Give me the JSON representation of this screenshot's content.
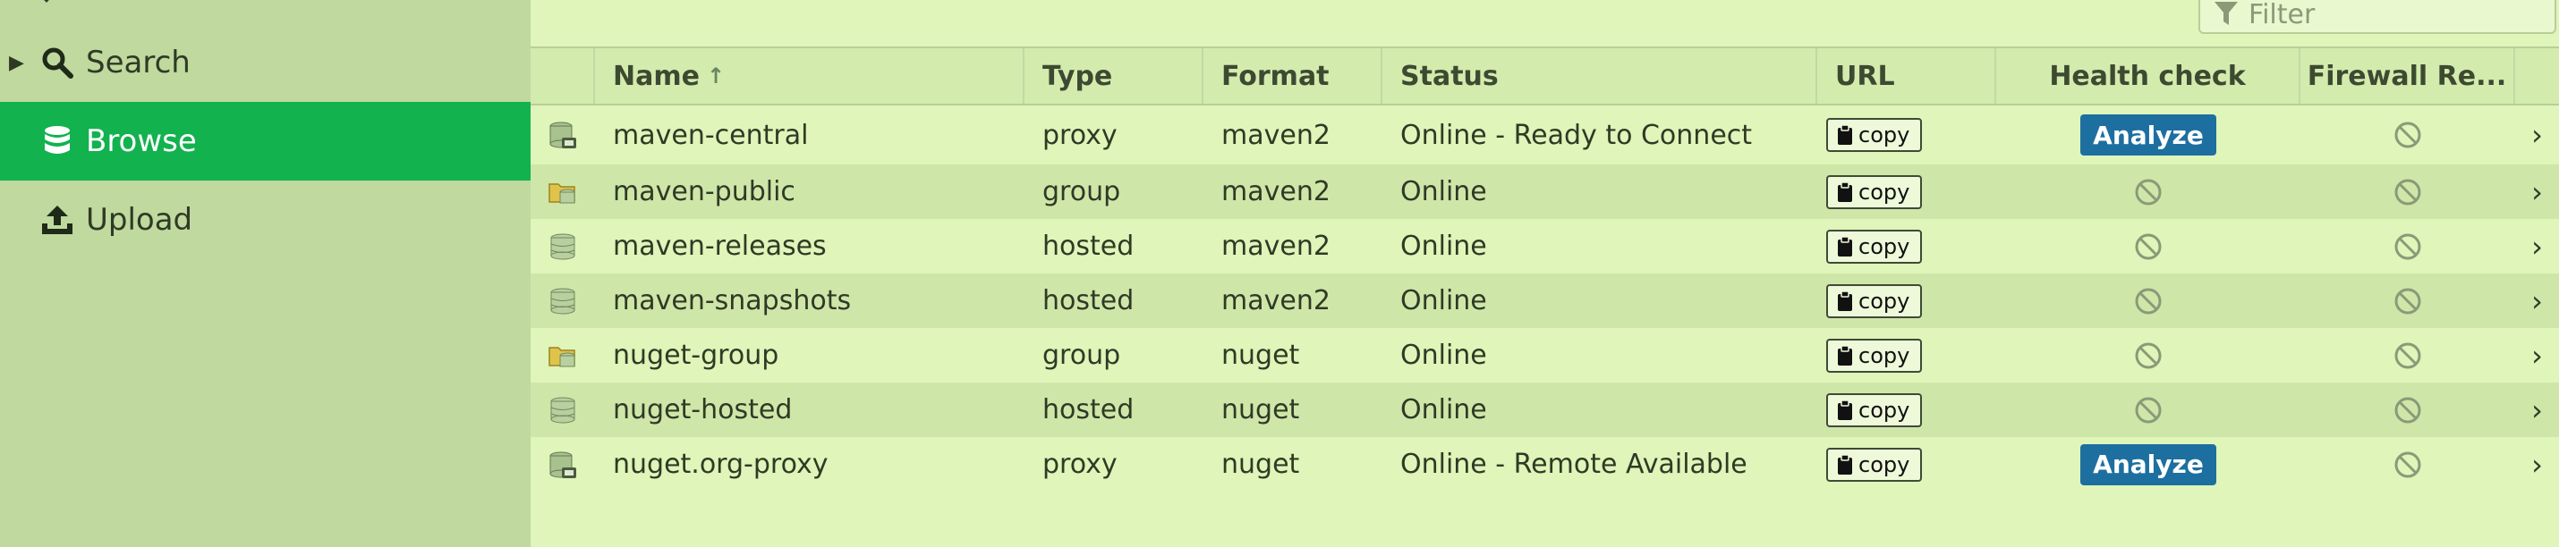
{
  "sidebar": {
    "items": [
      {
        "label": "Search",
        "icon": "search-icon"
      },
      {
        "label": "Browse",
        "icon": "database-icon",
        "active": true
      },
      {
        "label": "Upload",
        "icon": "upload-icon"
      }
    ]
  },
  "toolbar": {
    "filter_placeholder": "Filter"
  },
  "grid": {
    "columns": {
      "name": "Name",
      "type": "Type",
      "format": "Format",
      "status": "Status",
      "url": "URL",
      "health": "Health check",
      "firewall": "Firewall Re..."
    },
    "copy_label": "copy",
    "analyze_label": "Analyze",
    "rows": [
      {
        "name": "maven-central",
        "type": "proxy",
        "format": "maven2",
        "status": "Online - Ready to Connect",
        "health": "analyze",
        "icon": "proxy-repo-icon"
      },
      {
        "name": "maven-public",
        "type": "group",
        "format": "maven2",
        "status": "Online",
        "health": "disabled",
        "icon": "group-repo-icon"
      },
      {
        "name": "maven-releases",
        "type": "hosted",
        "format": "maven2",
        "status": "Online",
        "health": "disabled",
        "icon": "hosted-repo-icon"
      },
      {
        "name": "maven-snapshots",
        "type": "hosted",
        "format": "maven2",
        "status": "Online",
        "health": "disabled",
        "icon": "hosted-repo-icon"
      },
      {
        "name": "nuget-group",
        "type": "group",
        "format": "nuget",
        "status": "Online",
        "health": "disabled",
        "icon": "group-repo-icon"
      },
      {
        "name": "nuget-hosted",
        "type": "hosted",
        "format": "nuget",
        "status": "Online",
        "health": "disabled",
        "icon": "hosted-repo-icon"
      },
      {
        "name": "nuget.org-proxy",
        "type": "proxy",
        "format": "nuget",
        "status": "Online - Remote Available",
        "health": "analyze",
        "icon": "proxy-repo-icon"
      }
    ]
  },
  "colors": {
    "sidebar_bg": "#bfd99e",
    "active_nav": "#12b24f",
    "main_bg": "#dff5b9",
    "analyze_button": "#1d6fa0"
  }
}
